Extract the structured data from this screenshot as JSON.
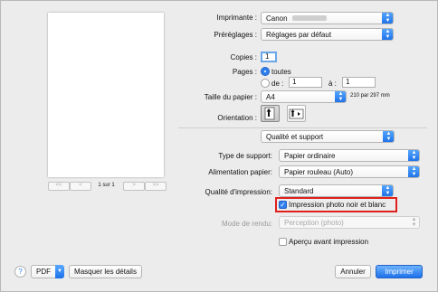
{
  "printer": {
    "label": "Imprimante :",
    "value": "Canon"
  },
  "presets": {
    "label": "Préréglages :",
    "value": "Réglages par défaut"
  },
  "copies": {
    "label": "Copies :",
    "value": "1"
  },
  "pages": {
    "label": "Pages :",
    "option_all": "toutes",
    "option_from": "de :",
    "from_value": "1",
    "to_label": "à :",
    "to_value": "1"
  },
  "paper_size": {
    "label": "Taille du papier :",
    "value": "A4",
    "dimensions": "210 par 297 mm"
  },
  "orientation": {
    "label": "Orientation :"
  },
  "section": {
    "value": "Qualité et support"
  },
  "media_type": {
    "label": "Type de support:",
    "value": "Papier ordinaire"
  },
  "paper_source": {
    "label": "Alimentation papier:",
    "value": "Papier rouleau (Auto)"
  },
  "print_quality": {
    "label": "Qualité d'impression:",
    "value": "Standard"
  },
  "bw_photo": {
    "label": "Impression photo noir et blanc",
    "checked": true
  },
  "render_mode": {
    "label": "Mode de rendu:",
    "value": "Perception (photo)"
  },
  "preview": {
    "label": "Aperçu avant impression",
    "checked": false
  },
  "preview_nav": {
    "page_indicator": "1 sur 1"
  },
  "footer": {
    "help": "?",
    "pdf": "PDF",
    "details": "Masquer les détails",
    "cancel": "Annuler",
    "print": "Imprimer"
  },
  "colors": {
    "accent": "#2f7fef",
    "highlight_border": "#e0201c"
  }
}
